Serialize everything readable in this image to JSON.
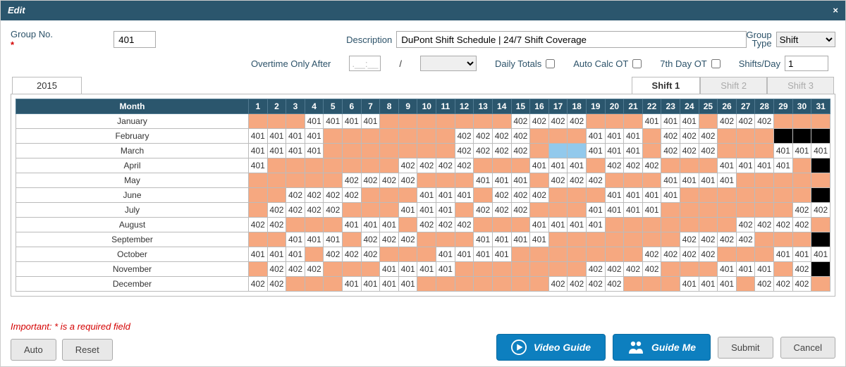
{
  "title": "Edit",
  "labels": {
    "groupNo": "Group No.",
    "description": "Description",
    "groupType": "Group\nType",
    "overtime": "Overtime Only After",
    "daily": "Daily Totals",
    "autocalc": "Auto Calc OT",
    "seventh": "7th Day OT",
    "shiftsDay": "Shifts/Day"
  },
  "fields": {
    "groupNo": "401",
    "description": "DuPont Shift Schedule | 24/7 Shift Coverage",
    "groupType": "Shift",
    "overtimeNum": ".__:__",
    "shiftsDay": "1"
  },
  "yearTab": "2015",
  "shiftTabs": [
    "Shift 1",
    "Shift 2",
    "Shift 3"
  ],
  "activeShiftTab": 0,
  "days": [
    "1",
    "2",
    "3",
    "4",
    "5",
    "6",
    "7",
    "8",
    "9",
    "10",
    "11",
    "12",
    "13",
    "14",
    "15",
    "16",
    "17",
    "18",
    "19",
    "20",
    "21",
    "22",
    "23",
    "24",
    "25",
    "26",
    "27",
    "28",
    "29",
    "30",
    "31"
  ],
  "monthHead": "Month",
  "months": [
    "January",
    "February",
    "March",
    "April",
    "May",
    "June",
    "July",
    "August",
    "September",
    "October",
    "November",
    "December"
  ],
  "schedule": [
    [
      "s",
      "s",
      "s",
      "c401:w",
      "c401:w",
      "c401:w",
      "c401:w",
      "s",
      "s",
      "s",
      "s",
      "s",
      "s",
      "s",
      "c402:w",
      "c402:w",
      "c402:w",
      "c402:w",
      "s",
      "s",
      "s",
      "c401:w",
      "c401:w",
      "c401:w",
      "s",
      "c402:w",
      "c402:w",
      "c402:w",
      "s",
      "s",
      "s"
    ],
    [
      "c401:w",
      "c401:w",
      "c401:w",
      "c401:w",
      "s",
      "s",
      "s",
      "s",
      "s",
      "s",
      "s",
      "c402:w",
      "c402:w",
      "c402:w",
      "c402:w",
      "s",
      "s",
      "s",
      "c401:w",
      "c401:w",
      "c401:w",
      "s",
      "c402:w",
      "c402:w",
      "c402:w",
      "s",
      "s",
      "s",
      "b",
      "b",
      "b"
    ],
    [
      "c401:w",
      "c401:w",
      "c401:w",
      "c401:w",
      "s",
      "s",
      "s",
      "s",
      "s",
      "s",
      "s",
      "c402:w",
      "c402:w",
      "c402:w",
      "c402:w",
      "s",
      "l",
      "l",
      "c401:w",
      "c401:w",
      "c401:w",
      "s",
      "c402:w",
      "c402:w",
      "c402:w",
      "s",
      "s",
      "s",
      "c401:w",
      "c401:w",
      "c401:w"
    ],
    [
      "c401:w",
      "s",
      "s",
      "s",
      "s",
      "s",
      "s",
      "s",
      "c402:w",
      "c402:w",
      "c402:w",
      "c402:w",
      "s",
      "s",
      "s",
      "c401:w",
      "c401:w",
      "c401:w",
      "s",
      "c402:w",
      "c402:w",
      "c402:w",
      "s",
      "s",
      "s",
      "c401:w",
      "c401:w",
      "c401:w",
      "c401:w",
      "s",
      "b"
    ],
    [
      "s",
      "s",
      "s",
      "s",
      "s",
      "c402:w",
      "c402:w",
      "c402:w",
      "c402:w",
      "s",
      "s",
      "s",
      "c401:w",
      "c401:w",
      "c401:w",
      "s",
      "c402:w",
      "c402:w",
      "c402:w",
      "s",
      "s",
      "s",
      "c401:w",
      "c401:w",
      "c401:w",
      "c401:w",
      "s",
      "s",
      "s",
      "s",
      "s"
    ],
    [
      "s",
      "s",
      "c402:w",
      "c402:w",
      "c402:w",
      "c402:w",
      "s",
      "s",
      "s",
      "c401:w",
      "c401:w",
      "c401:w",
      "s",
      "c402:w",
      "c402:w",
      "c402:w",
      "s",
      "s",
      "s",
      "c401:w",
      "c401:w",
      "c401:w",
      "c401:w",
      "s",
      "s",
      "s",
      "s",
      "s",
      "s",
      "s",
      "b"
    ],
    [
      "s",
      "c402:w",
      "c402:w",
      "c402:w",
      "c402:w",
      "s",
      "s",
      "s",
      "c401:w",
      "c401:w",
      "c401:w",
      "s",
      "c402:w",
      "c402:w",
      "c402:w",
      "s",
      "s",
      "s",
      "c401:w",
      "c401:w",
      "c401:w",
      "c401:w",
      "s",
      "s",
      "s",
      "s",
      "s",
      "s",
      "s",
      "c402:w",
      "c402:w"
    ],
    [
      "c402:w",
      "c402:w",
      "s",
      "s",
      "s",
      "c401:w",
      "c401:w",
      "c401:w",
      "s",
      "c402:w",
      "c402:w",
      "c402:w",
      "s",
      "s",
      "s",
      "c401:w",
      "c401:w",
      "c401:w",
      "c401:w",
      "s",
      "s",
      "s",
      "s",
      "s",
      "s",
      "s",
      "c402:w",
      "c402:w",
      "c402:w",
      "c402:w",
      "s"
    ],
    [
      "s",
      "s",
      "c401:w",
      "c401:w",
      "c401:w",
      "s",
      "c402:w",
      "c402:w",
      "c402:w",
      "s",
      "s",
      "s",
      "c401:w",
      "c401:w",
      "c401:w",
      "c401:w",
      "s",
      "s",
      "s",
      "s",
      "s",
      "s",
      "s",
      "c402:w",
      "c402:w",
      "c402:w",
      "c402:w",
      "s",
      "s",
      "s",
      "b"
    ],
    [
      "c401:w",
      "c401:w",
      "c401:w",
      "s",
      "c402:w",
      "c402:w",
      "c402:w",
      "s",
      "s",
      "s",
      "c401:w",
      "c401:w",
      "c401:w",
      "c401:w",
      "s",
      "s",
      "s",
      "s",
      "s",
      "s",
      "s",
      "c402:w",
      "c402:w",
      "c402:w",
      "c402:w",
      "s",
      "s",
      "s",
      "c401:w",
      "c401:w",
      "c401:w"
    ],
    [
      "s",
      "c402:w",
      "c402:w",
      "c402:w",
      "s",
      "s",
      "s",
      "c401:w",
      "c401:w",
      "c401:w",
      "c401:w",
      "s",
      "s",
      "s",
      "s",
      "s",
      "s",
      "s",
      "c402:w",
      "c402:w",
      "c402:w",
      "c402:w",
      "s",
      "s",
      "s",
      "c401:w",
      "c401:w",
      "c401:w",
      "s",
      "c402:w",
      "b"
    ],
    [
      "c402:w",
      "c402:w",
      "s",
      "s",
      "s",
      "c401:w",
      "c401:w",
      "c401:w",
      "c401:w",
      "s",
      "s",
      "s",
      "s",
      "s",
      "s",
      "s",
      "c402:w",
      "c402:w",
      "c402:w",
      "c402:w",
      "s",
      "s",
      "s",
      "c401:w",
      "c401:w",
      "c401:w",
      "s",
      "c402:w",
      "c402:w",
      "c402:w",
      "s"
    ]
  ],
  "footer": {
    "reqNote": "Important: * is a required field",
    "auto": "Auto",
    "reset": "Reset",
    "video": "Video Guide",
    "guide": "Guide Me",
    "submit": "Submit",
    "cancel": "Cancel"
  }
}
